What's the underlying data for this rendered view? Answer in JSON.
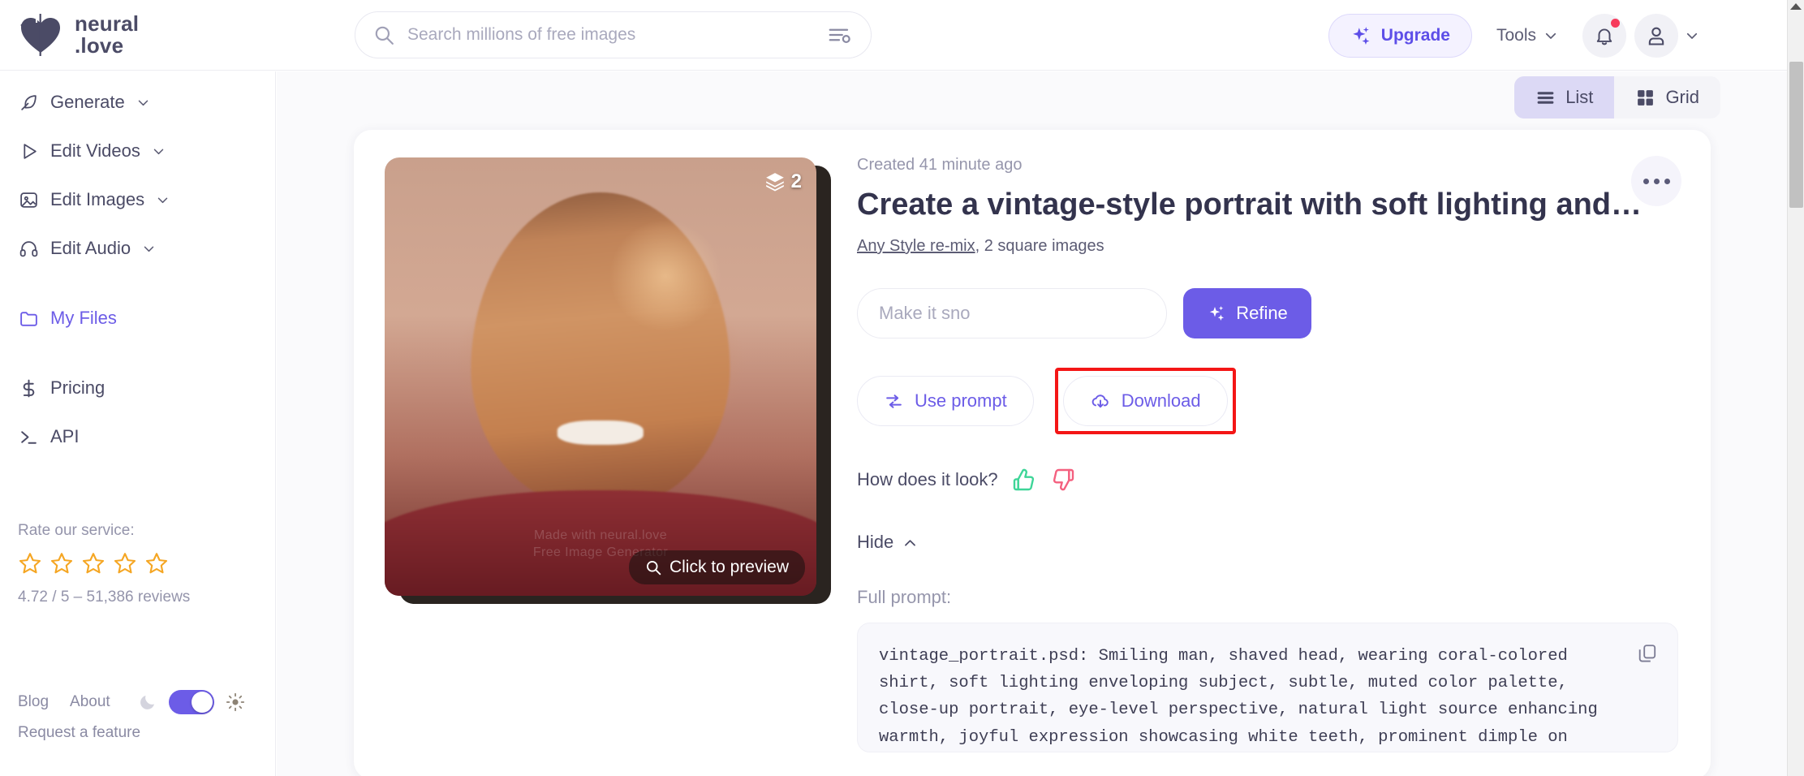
{
  "brand": {
    "name_line1": "neural",
    "name_line2": ".love",
    "logo_icon": "heart-logo-icon",
    "accent": "#6c5ce7"
  },
  "search": {
    "placeholder": "Search millions of free images",
    "value": "",
    "icon": "search-icon",
    "filter_icon": "search-filter-icon"
  },
  "header": {
    "upgrade_label": "Upgrade",
    "upgrade_icon": "sparkle-icon",
    "tools_label": "Tools",
    "tools_chevron": "chevron-down-icon",
    "notification_icon": "bell-icon",
    "notification_badge": true,
    "account_icon": "user-avatar-icon",
    "account_chevron": "chevron-down-icon"
  },
  "sidebar": {
    "items": [
      {
        "label": "Generate",
        "icon": "feather-icon",
        "chevron": true,
        "active": false
      },
      {
        "label": "Edit Videos",
        "icon": "play-icon",
        "chevron": true,
        "active": false
      },
      {
        "label": "Edit Images",
        "icon": "image-icon",
        "chevron": true,
        "active": false
      },
      {
        "label": "Edit Audio",
        "icon": "headphone-icon",
        "chevron": true,
        "active": false
      },
      {
        "label": "My Files",
        "icon": "folder-icon",
        "chevron": false,
        "active": true
      },
      {
        "label": "Pricing",
        "icon": "dollar-icon",
        "chevron": false,
        "active": false
      },
      {
        "label": "API",
        "icon": "terminal-icon",
        "chevron": false,
        "active": false
      }
    ],
    "rate": {
      "label": "Rate our service:",
      "stars": 5,
      "star_color": "#f5a623",
      "summary": "4.72 / 5 – 51,386 reviews"
    },
    "footer": {
      "blog": "Blog",
      "about": "About",
      "moon_icon": "moon-icon",
      "sun_icon": "sun-icon",
      "theme_toggle_on": true,
      "request": "Request a feature"
    }
  },
  "main": {
    "view_toggle": {
      "list_label": "List",
      "list_icon": "list-icon",
      "grid_label": "Grid",
      "grid_icon": "grid-icon",
      "selected": "List"
    },
    "card": {
      "created": "Created 41 minute ago",
      "title": "Create a vintage-style portrait with soft lighting and…",
      "style_link": "Any Style re-mix",
      "meta": ", 2 square images",
      "thumbnail": {
        "layers_count": "2",
        "layers_icon": "layers-icon",
        "preview_label": "Click to preview",
        "preview_icon": "magnifier-icon",
        "watermark_line1": "Made with neural.love",
        "watermark_line2": "Free Image Generator"
      },
      "refine": {
        "input_placeholder": "Make it sno",
        "input_value": "",
        "button_label": "Refine",
        "button_icon": "sparkle-icon"
      },
      "actions": {
        "use_prompt_label": "Use prompt",
        "use_prompt_icon": "shuffle-icon",
        "download_label": "Download",
        "download_icon": "cloud-download-icon",
        "download_highlight_color": "#f41616"
      },
      "feedback": {
        "label": "How does it look?",
        "thumbs_up_icon": "thumbs-up-icon",
        "thumbs_up_color": "#3ed598",
        "thumbs_down_icon": "thumbs-down-icon",
        "thumbs_down_color": "#f4607f"
      },
      "hide": {
        "label": "Hide",
        "icon": "chevron-up-icon"
      },
      "full_prompt": {
        "label": "Full prompt:",
        "text": "vintage_portrait.psd: Smiling man, shaved head, wearing coral-colored shirt, soft lighting enveloping subject, subtle, muted color palette, close-up portrait, eye-level perspective, natural light source enhancing warmth, joyful expression showcasing white teeth, prominent dimple on right cheek, background softly blurred in light hues emphasizing facial",
        "copy_icon": "copy-icon"
      },
      "more_menu_icon": "ellipsis-icon"
    }
  }
}
